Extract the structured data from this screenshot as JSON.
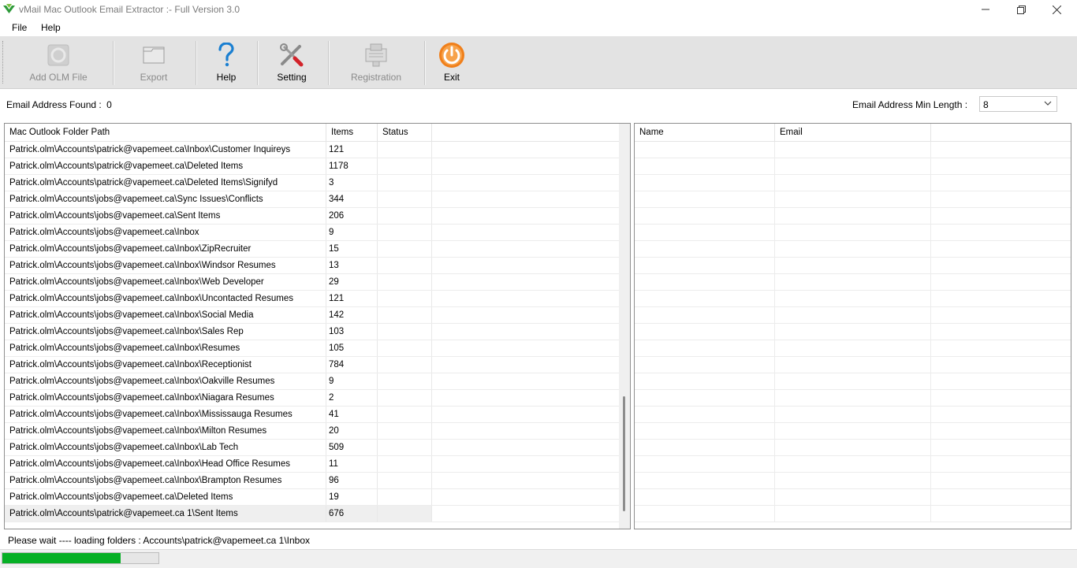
{
  "window": {
    "title": "vMail Mac Outlook Email Extractor :- Full Version 3.0",
    "minimize_icon": "minimize-icon",
    "maximize_icon": "restore-icon",
    "close_icon": "close-icon"
  },
  "menu": {
    "file": "File",
    "help": "Help"
  },
  "toolbar": {
    "add_olm": {
      "label": "Add OLM File",
      "icon": "add-file-icon",
      "enabled": false
    },
    "export": {
      "label": "Export",
      "icon": "export-folder-icon",
      "enabled": false
    },
    "help": {
      "label": "Help",
      "icon": "question-icon",
      "enabled": true
    },
    "setting": {
      "label": "Setting",
      "icon": "tools-icon",
      "enabled": true
    },
    "registration": {
      "label": "Registration",
      "icon": "registration-icon",
      "enabled": false
    },
    "exit": {
      "label": "Exit",
      "icon": "power-icon",
      "enabled": true
    }
  },
  "info": {
    "found_label": "Email Address Found :",
    "found_value": "0",
    "min_length_label": "Email Address Min Length :",
    "min_length_value": "8"
  },
  "folders_table": {
    "columns": [
      "Mac Outlook Folder Path",
      "Items",
      "Status"
    ],
    "rows": [
      {
        "path": "Patrick.olm\\Accounts\\patrick@vapemeet.ca\\Inbox\\Customer Inquireys",
        "items": "121",
        "status": ""
      },
      {
        "path": "Patrick.olm\\Accounts\\patrick@vapemeet.ca\\Deleted Items",
        "items": "1178",
        "status": ""
      },
      {
        "path": "Patrick.olm\\Accounts\\patrick@vapemeet.ca\\Deleted Items\\Signifyd",
        "items": "3",
        "status": ""
      },
      {
        "path": "Patrick.olm\\Accounts\\jobs@vapemeet.ca\\Sync Issues\\Conflicts",
        "items": "344",
        "status": ""
      },
      {
        "path": "Patrick.olm\\Accounts\\jobs@vapemeet.ca\\Sent Items",
        "items": "206",
        "status": ""
      },
      {
        "path": "Patrick.olm\\Accounts\\jobs@vapemeet.ca\\Inbox",
        "items": "9",
        "status": ""
      },
      {
        "path": "Patrick.olm\\Accounts\\jobs@vapemeet.ca\\Inbox\\ZipRecruiter",
        "items": "15",
        "status": ""
      },
      {
        "path": "Patrick.olm\\Accounts\\jobs@vapemeet.ca\\Inbox\\Windsor Resumes",
        "items": "13",
        "status": ""
      },
      {
        "path": "Patrick.olm\\Accounts\\jobs@vapemeet.ca\\Inbox\\Web Developer",
        "items": "29",
        "status": ""
      },
      {
        "path": "Patrick.olm\\Accounts\\jobs@vapemeet.ca\\Inbox\\Uncontacted Resumes",
        "items": "121",
        "status": ""
      },
      {
        "path": "Patrick.olm\\Accounts\\jobs@vapemeet.ca\\Inbox\\Social Media",
        "items": "142",
        "status": ""
      },
      {
        "path": "Patrick.olm\\Accounts\\jobs@vapemeet.ca\\Inbox\\Sales Rep",
        "items": "103",
        "status": ""
      },
      {
        "path": "Patrick.olm\\Accounts\\jobs@vapemeet.ca\\Inbox\\Resumes",
        "items": "105",
        "status": ""
      },
      {
        "path": "Patrick.olm\\Accounts\\jobs@vapemeet.ca\\Inbox\\Receptionist",
        "items": "784",
        "status": ""
      },
      {
        "path": "Patrick.olm\\Accounts\\jobs@vapemeet.ca\\Inbox\\Oakville Resumes",
        "items": "9",
        "status": ""
      },
      {
        "path": "Patrick.olm\\Accounts\\jobs@vapemeet.ca\\Inbox\\Niagara Resumes",
        "items": "2",
        "status": ""
      },
      {
        "path": "Patrick.olm\\Accounts\\jobs@vapemeet.ca\\Inbox\\Mississauga Resumes",
        "items": "41",
        "status": ""
      },
      {
        "path": "Patrick.olm\\Accounts\\jobs@vapemeet.ca\\Inbox\\Milton Resumes",
        "items": "20",
        "status": ""
      },
      {
        "path": "Patrick.olm\\Accounts\\jobs@vapemeet.ca\\Inbox\\Lab Tech",
        "items": "509",
        "status": ""
      },
      {
        "path": "Patrick.olm\\Accounts\\jobs@vapemeet.ca\\Inbox\\Head Office Resumes",
        "items": "11",
        "status": ""
      },
      {
        "path": "Patrick.olm\\Accounts\\jobs@vapemeet.ca\\Inbox\\Brampton Resumes",
        "items": "96",
        "status": ""
      },
      {
        "path": "Patrick.olm\\Accounts\\jobs@vapemeet.ca\\Deleted Items",
        "items": "19",
        "status": ""
      },
      {
        "path": "Patrick.olm\\Accounts\\patrick@vapemeet.ca 1\\Sent Items",
        "items": "676",
        "status": "",
        "selected": true
      }
    ]
  },
  "emails_table": {
    "columns": [
      "Name",
      "Email"
    ],
    "rows": []
  },
  "status": {
    "text": "Please wait ---- loading folders : Accounts\\patrick@vapemeet.ca 1\\Inbox",
    "progress_fraction": 0.76,
    "progress_color": "#06b025"
  }
}
